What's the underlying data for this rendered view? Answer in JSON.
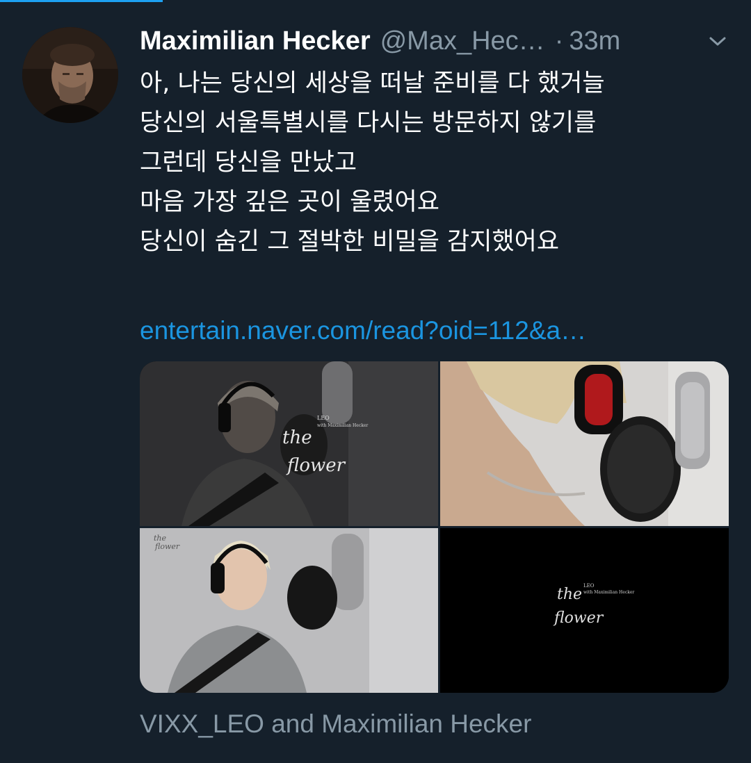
{
  "tweet": {
    "author_name": "Maximilian Hecker",
    "author_handle": "@Max_Hec…",
    "separator": "·",
    "time": "33m",
    "lines": [
      "아, 나는 당신의 세상을 떠날 준비를 다 했거늘",
      "당신의 서울특별시를 다시는 방문하지 않기를",
      "그런데 당신을 만났고",
      "마음 가장 깊은 곳이 울렸어요",
      "당신이 숨긴 그 절박한 비밀을 감지했어요"
    ],
    "link_text": "entertain.naver.com/read?oid=112&a…"
  },
  "media": {
    "caption": "VIXX_LEO and Maximilian Hecker",
    "card_text": {
      "credit": "LEO",
      "credit_sub": "with Maximilian Hecker",
      "title_line_1": "the",
      "title_line_2": "flower"
    }
  },
  "icons": {
    "chevron": "chevron-down-icon"
  },
  "colors": {
    "background": "#15202b",
    "link": "#1b95e0",
    "secondary_text": "#8899a6",
    "accent": "#1da1f2"
  }
}
